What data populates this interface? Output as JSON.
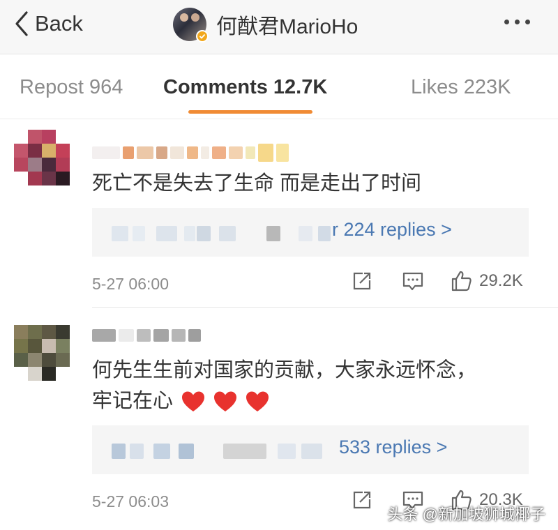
{
  "header": {
    "back_label": "Back",
    "title": "何猷君MarioHo",
    "verified_color": "#f2a81d"
  },
  "tabs": [
    {
      "label": "Repost 964",
      "active": false
    },
    {
      "label": "Comments 12.7K",
      "active": true
    },
    {
      "label": "Likes 223K",
      "active": false
    }
  ],
  "accent_color": "#f08b34",
  "link_color": "#4a78b2",
  "comments": [
    {
      "text": "死亡不是失去了生命 而是走出了时间",
      "replies_label": "r 224 replies >",
      "time": "5-27 06:00",
      "likes": "29.2K"
    },
    {
      "text_line1": "何先生生前对国家的贡献，大家永远怀念，",
      "text_line2": "牢记在心",
      "replies_label": "533 replies >",
      "time": "5-27 06:03",
      "likes": "20.3K"
    }
  ],
  "watermark": "头条 @新加坡狮城椰子"
}
